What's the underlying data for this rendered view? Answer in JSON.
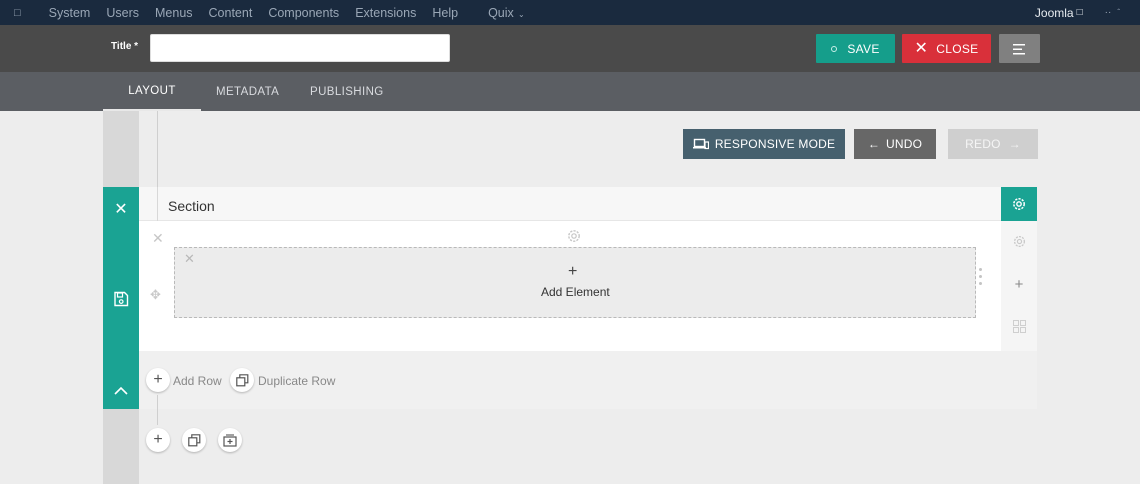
{
  "menubar": {
    "items": [
      "System",
      "Users",
      "Menus",
      "Content",
      "Components",
      "Extensions",
      "Help"
    ],
    "quix": "Quix",
    "site_name": "Joomla",
    "site_suffix": "↗",
    "user_label": "··"
  },
  "toolbar": {
    "title_label": "Title *",
    "title_value": "",
    "save_label": "SAVE",
    "close_label": "CLOSE"
  },
  "tabs": [
    {
      "label": "LAYOUT",
      "active": true
    },
    {
      "label": "METADATA",
      "active": false
    },
    {
      "label": "PUBLISHING",
      "active": false
    }
  ],
  "builder": {
    "responsive_label": "RESPONSIVE MODE",
    "undo_label": "UNDO",
    "redo_label": "REDO",
    "section_title": "Section",
    "add_element_label": "Add Element",
    "add_row_label": "Add Row",
    "duplicate_row_label": "Duplicate Row"
  },
  "colors": {
    "accent": "#1aa393",
    "save": "#159e8b",
    "close": "#d9303a",
    "menubar": "#1a2a3e",
    "toolbar": "#4a4a4a",
    "tabs": "#5b5e63"
  }
}
